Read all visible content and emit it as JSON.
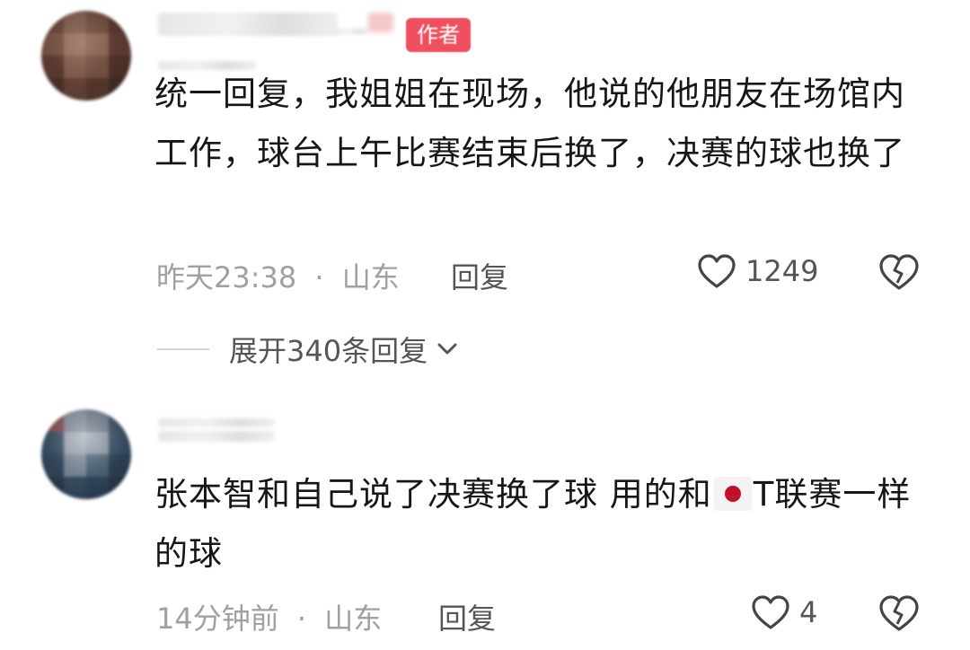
{
  "comments": [
    {
      "author_badge": "作者",
      "text": "统一回复，我姐姐在现场，他说的他朋友在场馆内工作，球台上午比赛结束后换了，决赛的球也换了",
      "time": "昨天23:38",
      "separator": "·",
      "location": "山东",
      "reply_label": "回复",
      "likes": "1249",
      "expand_label": "展开340条回复"
    },
    {
      "text_before_flag": "张本智和自己说了决赛换了球 用的和",
      "text_after_flag": "T联赛一样的球",
      "time": "14分钟前",
      "separator": "·",
      "location": "山东",
      "reply_label": "回复",
      "likes": "4"
    }
  ],
  "icons": {
    "like": "heart-outline-icon",
    "dislike": "broken-heart-icon",
    "expand": "chevron-down-icon",
    "flag": "japan-flag-emoji"
  },
  "colors": {
    "badge": "#f0505e",
    "meta_text": "#a0a0a0",
    "body_text": "#161616",
    "flag_red": "#c2102a"
  }
}
